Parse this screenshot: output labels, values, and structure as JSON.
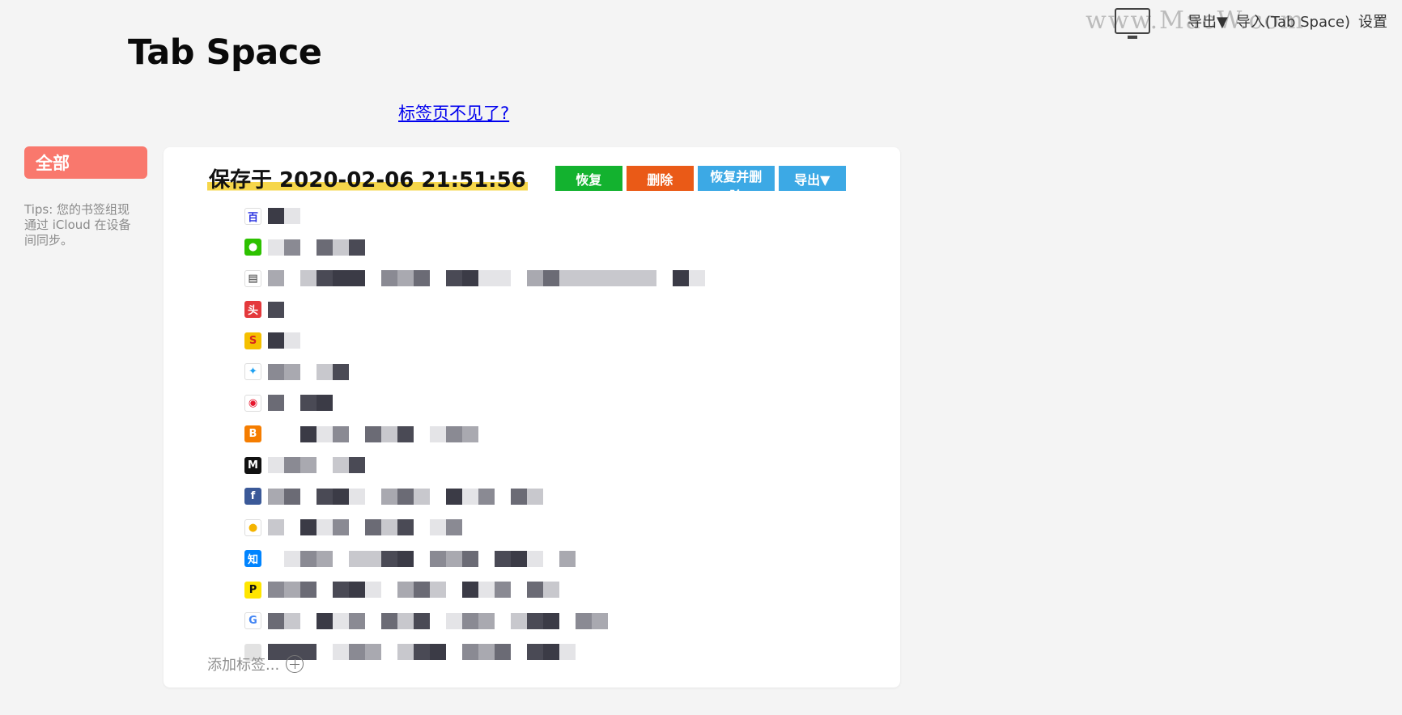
{
  "app": {
    "title": "Tab Space"
  },
  "top_menu": {
    "export_label": "导出▼",
    "import_label": "导入(Tab Space)",
    "settings_label": "设置"
  },
  "watermark": "www.MacW.com",
  "lost_tabs_link": "标签页不见了?",
  "sidebar": {
    "all_label": "全部",
    "tips": "Tips: 您的书签组现通过 iCloud 在设备间同步。"
  },
  "group": {
    "saved_at": "保存于 2020-02-06 21:51:56",
    "buttons": {
      "restore": "恢复",
      "delete": "删除",
      "restore_and_delete": "恢复并删除",
      "export": "导出▼"
    },
    "add_tag_label": "添加标签...",
    "tabs": [
      {
        "icon": "baidu-icon",
        "glyph": "百",
        "fav_bg": "#ffffff",
        "fav_fg": "#2932e1"
      },
      {
        "icon": "wechat-icon",
        "glyph": "●",
        "fav_bg": "#2dc100",
        "fav_fg": "#ffffff"
      },
      {
        "icon": "document-icon",
        "glyph": "▤",
        "fav_bg": "#ffffff",
        "fav_fg": "#333333"
      },
      {
        "icon": "toutiao-icon",
        "glyph": "头",
        "fav_bg": "#e4393c",
        "fav_fg": "#ffffff"
      },
      {
        "icon": "sspai-icon",
        "glyph": "S",
        "fav_bg": "#f5c000",
        "fav_fg": "#d7261d"
      },
      {
        "icon": "twitter-icon",
        "glyph": "✦",
        "fav_bg": "#ffffff",
        "fav_fg": "#1da1f2"
      },
      {
        "icon": "weibo-icon",
        "glyph": "◉",
        "fav_bg": "#ffffff",
        "fav_fg": "#e6162d"
      },
      {
        "icon": "blogger-icon",
        "glyph": "B",
        "fav_bg": "#f57d00",
        "fav_fg": "#ffffff"
      },
      {
        "icon": "medium-icon",
        "glyph": "M",
        "fav_bg": "#111111",
        "fav_fg": "#ffffff"
      },
      {
        "icon": "facebook-icon",
        "glyph": "f",
        "fav_bg": "#3b5998",
        "fav_fg": "#ffffff"
      },
      {
        "icon": "qq-icon",
        "glyph": "●",
        "fav_bg": "#ffffff",
        "fav_fg": "#f4b400"
      },
      {
        "icon": "zhihu-icon",
        "glyph": "知",
        "fav_bg": "#0084ff",
        "fav_fg": "#ffffff"
      },
      {
        "icon": "producthunt-icon",
        "glyph": "P",
        "fav_bg": "#ffe600",
        "fav_fg": "#111111"
      },
      {
        "icon": "google-icon",
        "glyph": "G",
        "fav_bg": "#ffffff",
        "fav_fg": "#4285f4"
      },
      {
        "icon": "blank-icon",
        "glyph": "",
        "fav_bg": "#e2e2e2",
        "fav_fg": "#e2e2e2"
      }
    ]
  }
}
